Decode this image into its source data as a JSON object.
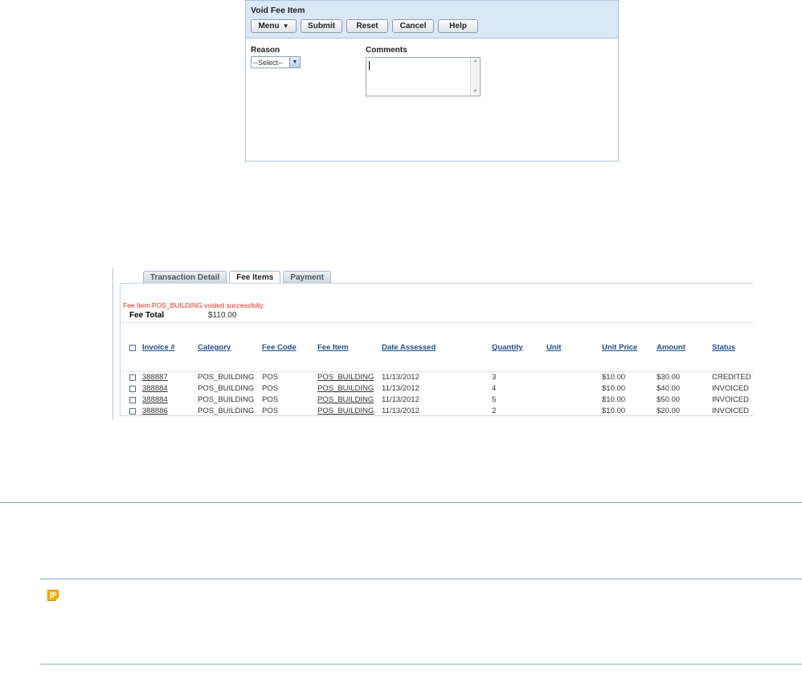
{
  "dialog": {
    "title": "Void Fee Item",
    "buttons": {
      "menu": "Menu",
      "submit": "Submit",
      "reset": "Reset",
      "cancel": "Cancel",
      "help": "Help"
    },
    "reason_label": "Reason",
    "reason_selected": "--Select--",
    "comments_label": "Comments",
    "comments_value": ""
  },
  "fee_panel": {
    "tabs": [
      {
        "label": "Transaction Detail",
        "active": false
      },
      {
        "label": "Fee Items",
        "active": true
      },
      {
        "label": "Payment",
        "active": false
      }
    ],
    "message": "Fee Item POS_BUILDING voided successfully.",
    "fee_total_label": "Fee Total",
    "fee_total_value": "$110.00",
    "columns": [
      "Invoice #",
      "Category",
      "Fee Code",
      "Fee Item",
      "Date Assessed",
      "Quantity",
      "Unit",
      "Unit Price",
      "Amount",
      "Status"
    ],
    "rows": [
      {
        "invoice": "388887",
        "category": "POS_BUILDING",
        "fee_code": "POS",
        "fee_item": "POS_BUILDING",
        "date": "11/13/2012",
        "quantity": "3",
        "unit": "",
        "unit_price": "$10.00",
        "amount": "$30.00",
        "status": "CREDITED"
      },
      {
        "invoice": "388884",
        "category": "POS_BUILDING",
        "fee_code": "POS",
        "fee_item": "POS_BUILDING",
        "date": "11/13/2012",
        "quantity": "4",
        "unit": "",
        "unit_price": "$10.00",
        "amount": "$40.00",
        "status": "INVOICED"
      },
      {
        "invoice": "388884",
        "category": "POS_BUILDING",
        "fee_code": "POS",
        "fee_item": "POS_BUILDING",
        "date": "11/13/2012",
        "quantity": "5",
        "unit": "",
        "unit_price": "$10.00",
        "amount": "$50.00",
        "status": "INVOICED"
      },
      {
        "invoice": "388886",
        "category": "POS_BUILDING",
        "fee_code": "POS",
        "fee_item": "POS_BUILDING",
        "date": "11/13/2012",
        "quantity": "2",
        "unit": "",
        "unit_price": "$10.00",
        "amount": "$20.00",
        "status": "INVOICED"
      }
    ]
  },
  "icons": {
    "note": "note-icon",
    "menu_caret": "caret-down-icon",
    "select_arrow": "chevron-down-icon"
  },
  "colors": {
    "header_bg": "#dae8f6",
    "link": "#1f4e8c",
    "success_message": "#e8271b",
    "rule": "#86a9c8",
    "note_icon": "#f4b400"
  }
}
